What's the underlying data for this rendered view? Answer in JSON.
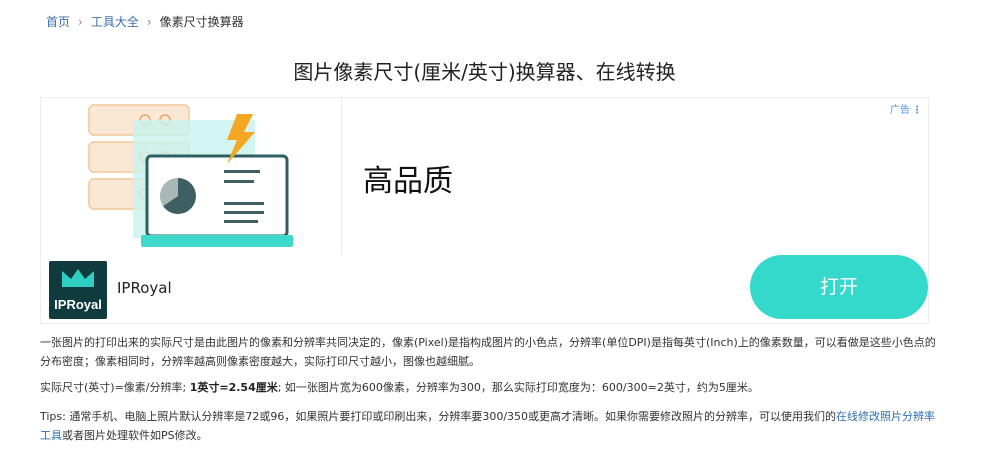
{
  "breadcrumb": {
    "home": "首页",
    "tools": "工具大全",
    "current": "像素尺寸换算器",
    "separator": "›"
  },
  "page_title": "图片像素尺寸(厘米/英寸)换算器、在线转换",
  "ad": {
    "tag": "广告",
    "headline": "高品质",
    "brand_logo_text": "IPRoyal",
    "brand_name": "IPRoyal",
    "cta": "打开",
    "colors": {
      "cta": "#35d9cc",
      "logo_bg": "#0f3b3e"
    }
  },
  "content": {
    "p1": "一张图片的打印出来的实际尺寸是由此图片的像素和分辨率共同决定的，像素(Pixel)是指构成图片的小色点，分辨率(单位DPI)是指每英寸(Inch)上的像素数量，可以看做是这些小色点的分布密度；像素相同时，分辨率越高则像素密度越大，实际打印尺寸越小，图像也越细腻。",
    "p2_pre": "实际尺寸(英寸)=像素/分辨率; ",
    "p2_bold": "1英寸=2.54厘米",
    "p2_post": "; 如一张图片宽为600像素，分辨率为300，那么实际打印宽度为：600/300=2英寸，约为5厘米。",
    "p3_pre": "Tips: 通常手机、电脑上照片默认分辨率是72或96，如果照片要打印或印刷出来，分辨率要300/350或更高才清晰。如果你需要修改照片的分辨率，可以使用我们的",
    "p3_link": "在线修改照片分辨率工具",
    "p3_post": "或者图片处理软件如PS修改。"
  }
}
